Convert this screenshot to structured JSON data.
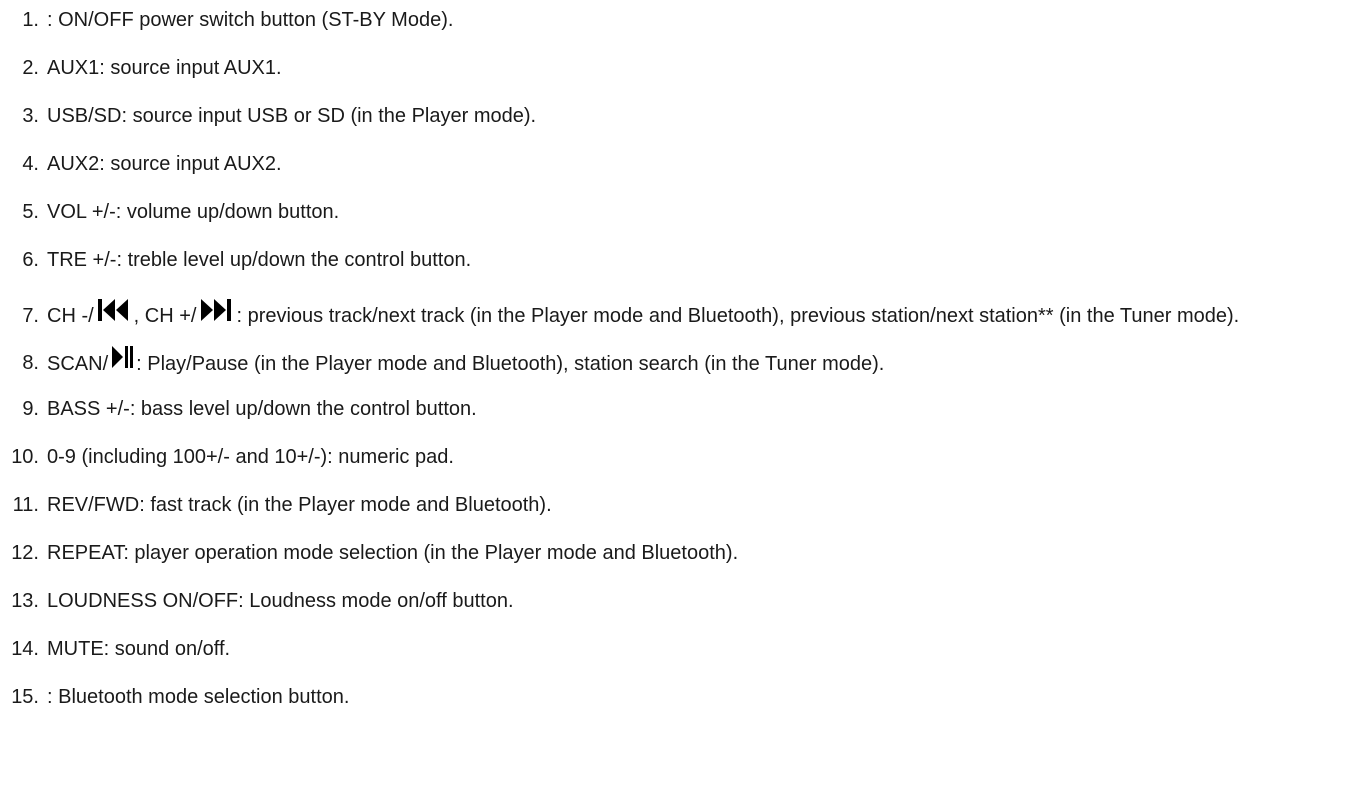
{
  "items": [
    {
      "number": "1.",
      "text": ": ON/OFF power switch button (ST-BY Mode)."
    },
    {
      "number": "2.",
      "text": "AUX1: source input AUX1."
    },
    {
      "number": "3.",
      "text": "USB/SD: source input USB or SD (in the Player mode)."
    },
    {
      "number": "4.",
      "text": "AUX2: source input AUX2."
    },
    {
      "number": "5.",
      "text": "VOL +/-: volume up/down button."
    },
    {
      "number": "6.",
      "text": "TRE +/-: treble level up/down the control button."
    },
    {
      "number": "7.",
      "part1": "CH -/",
      "icon1": "previous-track-icon",
      "part2": ", CH +/",
      "icon2": "next-track-icon",
      "part3": ": previous track/next track (in the Player mode and Bluetooth), previous station/next station** (in the Tuner mode)."
    },
    {
      "number": "8.",
      "part1": "SCAN/",
      "icon1": "play-pause-icon",
      "part2": ": Play/Pause (in the Player mode and Bluetooth), station search (in the Tuner mode)."
    },
    {
      "number": "9.",
      "text": "BASS +/-: bass level up/down the control button."
    },
    {
      "number": "10.",
      "text": "0-9 (including 100+/- and 10+/-): numeric pad."
    },
    {
      "number": "11.",
      "text": "REV/FWD: fast track (in the Player mode and Bluetooth)."
    },
    {
      "number": "12.",
      "text": "REPEAT: player operation mode selection (in the Player mode and Bluetooth)."
    },
    {
      "number": "13.",
      "text": "LOUDNESS ON/OFF: Loudness mode on/off button."
    },
    {
      "number": "14.",
      "text": "MUTE: sound on/off."
    },
    {
      "number": "15.",
      "text": ": Bluetooth mode selection button."
    }
  ],
  "colors": {
    "text": "#1a1a1a",
    "background": "#ffffff"
  }
}
